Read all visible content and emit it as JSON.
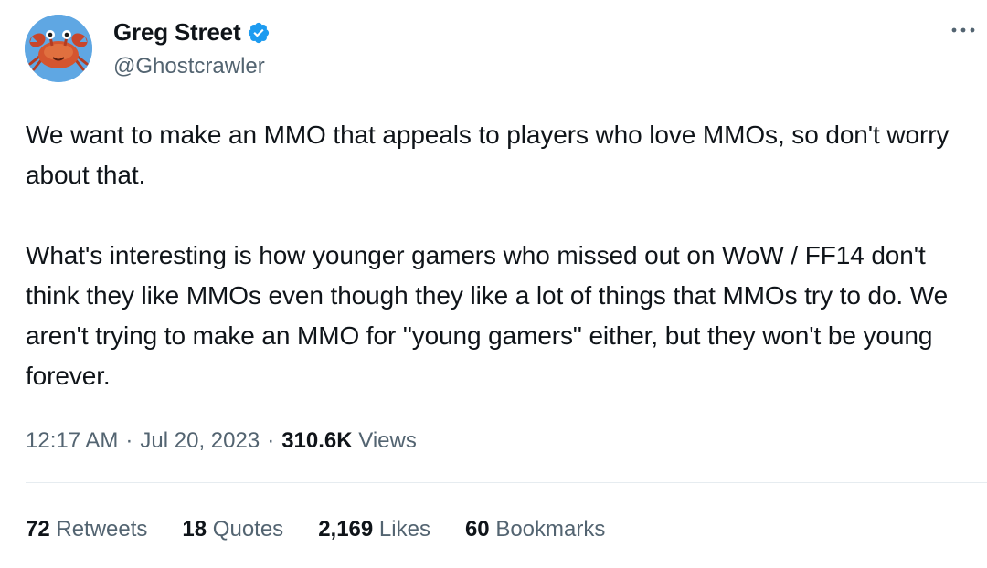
{
  "author": {
    "name": "Greg Street",
    "handle": "@Ghostcrawler",
    "verified": true,
    "avatar_icon": "crab-avatar-icon"
  },
  "colors": {
    "verified_badge": "#1d9bf0",
    "avatar_background": "#5fa7e3",
    "secondary_text": "#536471",
    "primary_text": "#0f1419"
  },
  "tweet": {
    "paragraphs": [
      "We want to make an MMO that appeals to players who love MMOs, so don't worry about that.",
      "What's interesting is how younger gamers who missed out on WoW / FF14 don't think they like MMOs even though they like a lot of things that MMOs try to do. We aren't trying to make an MMO for \"young gamers\" either, but they won't be young forever."
    ]
  },
  "meta": {
    "time": "12:17 AM",
    "separator": "·",
    "date": "Jul 20, 2023",
    "views_count": "310.6K",
    "views_label": "Views"
  },
  "stats": {
    "retweets": {
      "count": "72",
      "label": "Retweets"
    },
    "quotes": {
      "count": "18",
      "label": "Quotes"
    },
    "likes": {
      "count": "2,169",
      "label": "Likes"
    },
    "bookmarks": {
      "count": "60",
      "label": "Bookmarks"
    }
  }
}
